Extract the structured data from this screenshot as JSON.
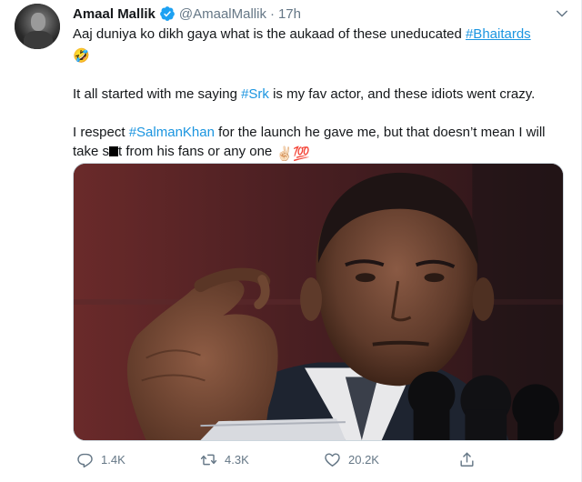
{
  "tweet": {
    "author_name": "Amaal Mallik",
    "handle": "@AmaalMallik",
    "separator": "·",
    "time": "17h",
    "line1_text": "Aaj duniya ko dikh gaya what is the aukaad of these uneducated ",
    "line1_hashtag": "#Bhaitards",
    "line1_emoji": "🤣",
    "para2_before": "It all started with me saying ",
    "para2_hashtag": "#Srk",
    "para2_after": " is my fav actor, and these idiots went crazy.",
    "para3_before": "I respect ",
    "para3_hashtag": "#SalmanKhan",
    "para3_mid": " for the launch he gave me, but that doesn’t mean I will take s",
    "para3_after": "t from his fans or any one ",
    "para3_emoji1": "✌🏻",
    "para3_emoji2": "💯"
  },
  "actions": {
    "reply_count": "1.4K",
    "retweet_count": "4.3K",
    "like_count": "20.2K"
  },
  "icons": {
    "verified": "verified-badge-icon",
    "caret": "chevron-down-icon",
    "reply": "reply-icon",
    "retweet": "retweet-icon",
    "like": "heart-icon",
    "share": "share-icon"
  },
  "colors": {
    "link": "#1b95e0",
    "verified": "#1da1f2",
    "muted": "#657786",
    "text": "#14171a"
  }
}
